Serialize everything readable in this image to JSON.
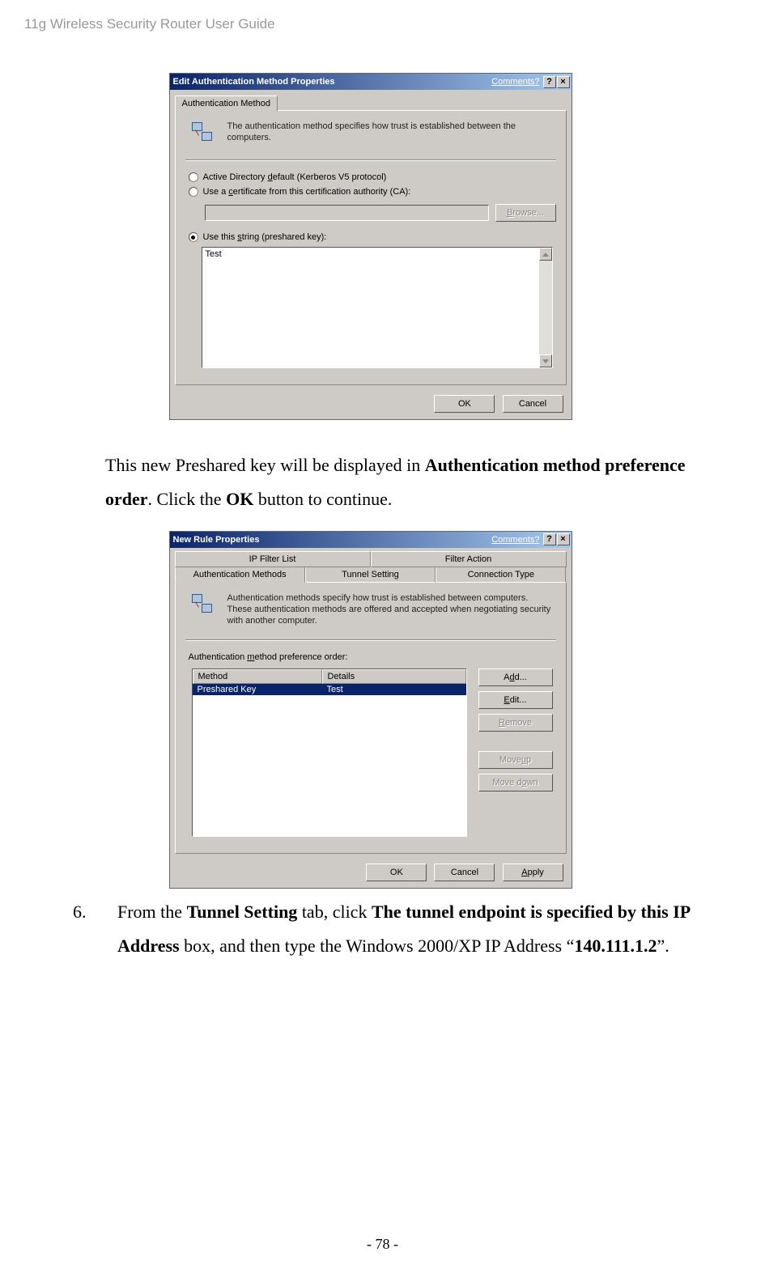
{
  "header": "11g Wireless Security Router User Guide",
  "dialog1": {
    "title": "Edit Authentication Method Properties",
    "comments": "Comments?",
    "help": "?",
    "close": "×",
    "tab": "Authentication Method",
    "description": "The authentication method specifies how trust is established between the computers.",
    "radio_ad": "Active Directory default (Kerberos V5 protocol)",
    "radio_ca": "Use a certificate from this certification authority (CA):",
    "browse": "Browse...",
    "radio_psk": "Use this string (preshared key):",
    "psk_value": "Test",
    "ok": "OK",
    "cancel": "Cancel"
  },
  "paragraph1_pre": "This new Preshared key will be displayed in ",
  "paragraph1_bold": "Authentication method preference order",
  "paragraph1_mid": ". Click the ",
  "paragraph1_bold2": "OK",
  "paragraph1_end": " button to continue.",
  "dialog2": {
    "title": "New Rule Properties",
    "comments": "Comments?",
    "tabs_row1": {
      "a": "IP Filter List",
      "b": "Filter Action"
    },
    "tabs_row2": {
      "a": "Authentication Methods",
      "b": "Tunnel Setting",
      "c": "Connection Type"
    },
    "description": "Authentication methods specify how trust is established between computers. These authentication methods are offered and accepted when negotiating security with another computer.",
    "label": "Authentication method preference order:",
    "col_method": "Method",
    "col_details": "Details",
    "row_method": "Preshared Key",
    "row_details": "Test",
    "btn_add": "Add...",
    "btn_edit": "Edit...",
    "btn_remove": "Remove",
    "btn_moveup": "Move up",
    "btn_movedown": "Move down",
    "ok": "OK",
    "cancel": "Cancel",
    "apply": "Apply"
  },
  "step6_num": "6.",
  "step6_a": "From the ",
  "step6_b": "Tunnel Setting",
  "step6_c": " tab, click ",
  "step6_d": "The tunnel endpoint is specified by this IP Address",
  "step6_e": " box, and then type the Windows 2000/XP IP Address “",
  "step6_f": "140.111.1.2",
  "step6_g": "”.",
  "page_number": "- 78 -"
}
